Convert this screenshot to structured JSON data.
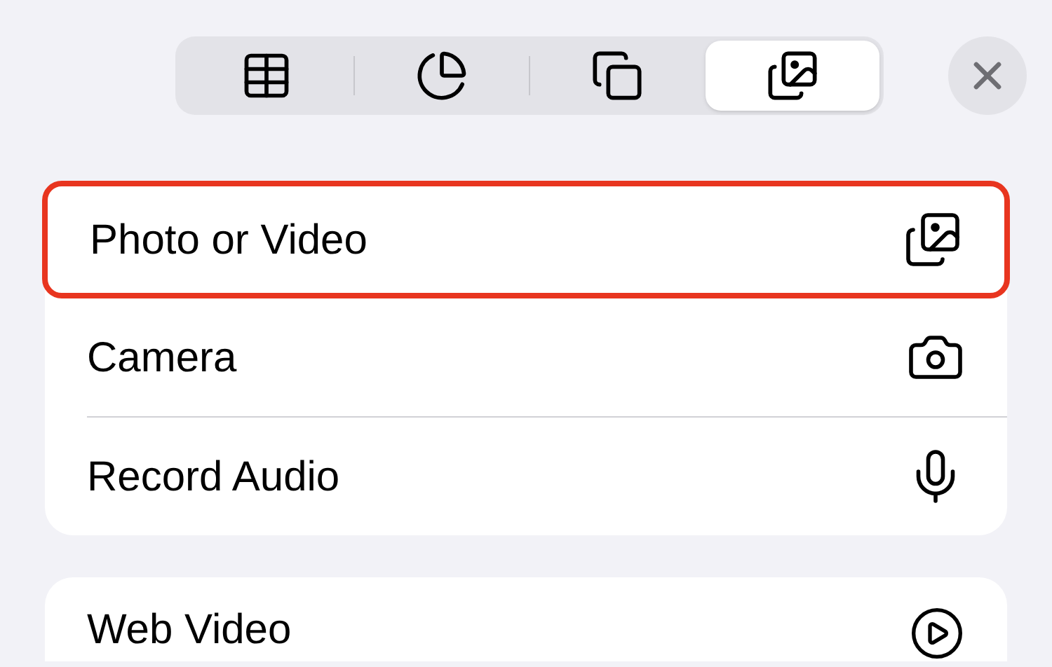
{
  "segments": [
    {
      "selected": false
    },
    {
      "selected": false
    },
    {
      "selected": false
    },
    {
      "selected": true
    }
  ],
  "menu": [
    {
      "label": "Photo or Video",
      "highlighted": true
    },
    {
      "label": "Camera",
      "highlighted": false
    },
    {
      "label": "Record Audio",
      "highlighted": false
    }
  ],
  "more": [
    {
      "label": "Web Video"
    }
  ]
}
